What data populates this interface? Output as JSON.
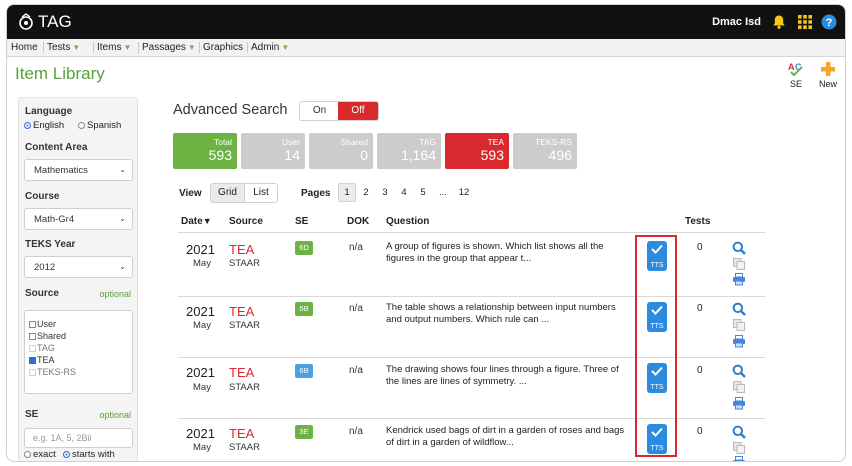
{
  "app": {
    "title": "TAG",
    "user_name": "Dmac Isd"
  },
  "menu": [
    "Home",
    "Tests",
    "Items",
    "Passages",
    "Graphics",
    "Admin"
  ],
  "page_title": "Item Library",
  "toolbar": {
    "se_label": "SE",
    "new_label": "New"
  },
  "filters": {
    "language_label": "Language",
    "language_options": [
      "English",
      "Spanish"
    ],
    "content_area_label": "Content Area",
    "content_area_value": "Mathematics",
    "course_label": "Course",
    "course_value": "Math-Gr4",
    "teks_year_label": "TEKS Year",
    "teks_year_value": "2012",
    "source_label": "Source",
    "source_optional": "optional",
    "source_options": [
      "User",
      "Shared",
      "TAG",
      "TEA",
      "TEKS-RS"
    ],
    "se_label": "SE",
    "se_optional": "optional",
    "se_placeholder": "e.g. 1A, 5, 2Bii",
    "match_options": [
      "exact",
      "starts with"
    ]
  },
  "advanced_search": {
    "label": "Advanced Search",
    "on_label": "On",
    "off_label": "Off"
  },
  "stats": [
    {
      "label": "Total",
      "value": "593",
      "color": "#6db344"
    },
    {
      "label": "User",
      "value": "14",
      "color": "#cccccc"
    },
    {
      "label": "Shared",
      "value": "0",
      "color": "#cccccc"
    },
    {
      "label": "TAG",
      "value": "1,164",
      "color": "#cccccc"
    },
    {
      "label": "TEA",
      "value": "593",
      "color": "#d8292f"
    },
    {
      "label": "TEKS-RS",
      "value": "496",
      "color": "#cccccc"
    }
  ],
  "view": {
    "label": "View",
    "grid_label": "Grid",
    "list_label": "List"
  },
  "pagination": {
    "label": "Pages",
    "pages": [
      "1",
      "2",
      "3",
      "4",
      "5",
      "...",
      "12"
    ]
  },
  "table": {
    "headers": {
      "date": "Date",
      "sort_arrow": "▼",
      "source": "Source",
      "se": "SE",
      "dok": "DOK",
      "question": "Question",
      "tests": "Tests"
    },
    "rows": [
      {
        "year": "2021",
        "month": "May",
        "source": "TEA",
        "sub": "STAAR",
        "se": "6D",
        "se_color": "#6db344",
        "dok": "n/a",
        "question": "A group of figures is shown. Which list shows all the figures in the group that appear t...",
        "tts": "TTS",
        "tests": "0"
      },
      {
        "year": "2021",
        "month": "May",
        "source": "TEA",
        "sub": "STAAR",
        "se": "5B",
        "se_color": "#6db344",
        "dok": "n/a",
        "question": "The table shows a relationship between input numbers and output numbers. Which rule can ...",
        "tts": "TTS",
        "tests": "0"
      },
      {
        "year": "2021",
        "month": "May",
        "source": "TEA",
        "sub": "STAAR",
        "se": "6B",
        "se_color": "#4a9fe0",
        "dok": "n/a",
        "question": "The drawing shows four lines through a figure. Three of the lines are lines of symmetry. ...",
        "tts": "TTS",
        "tests": "0"
      },
      {
        "year": "2021",
        "month": "May",
        "source": "TEA",
        "sub": "STAAR",
        "se": "3E",
        "se_color": "#6db344",
        "dok": "n/a",
        "question": "Kendrick used  bags of dirt in a garden of roses and bags of dirt in a garden of wildflow...",
        "tts": "TTS",
        "tests": "0"
      }
    ]
  }
}
